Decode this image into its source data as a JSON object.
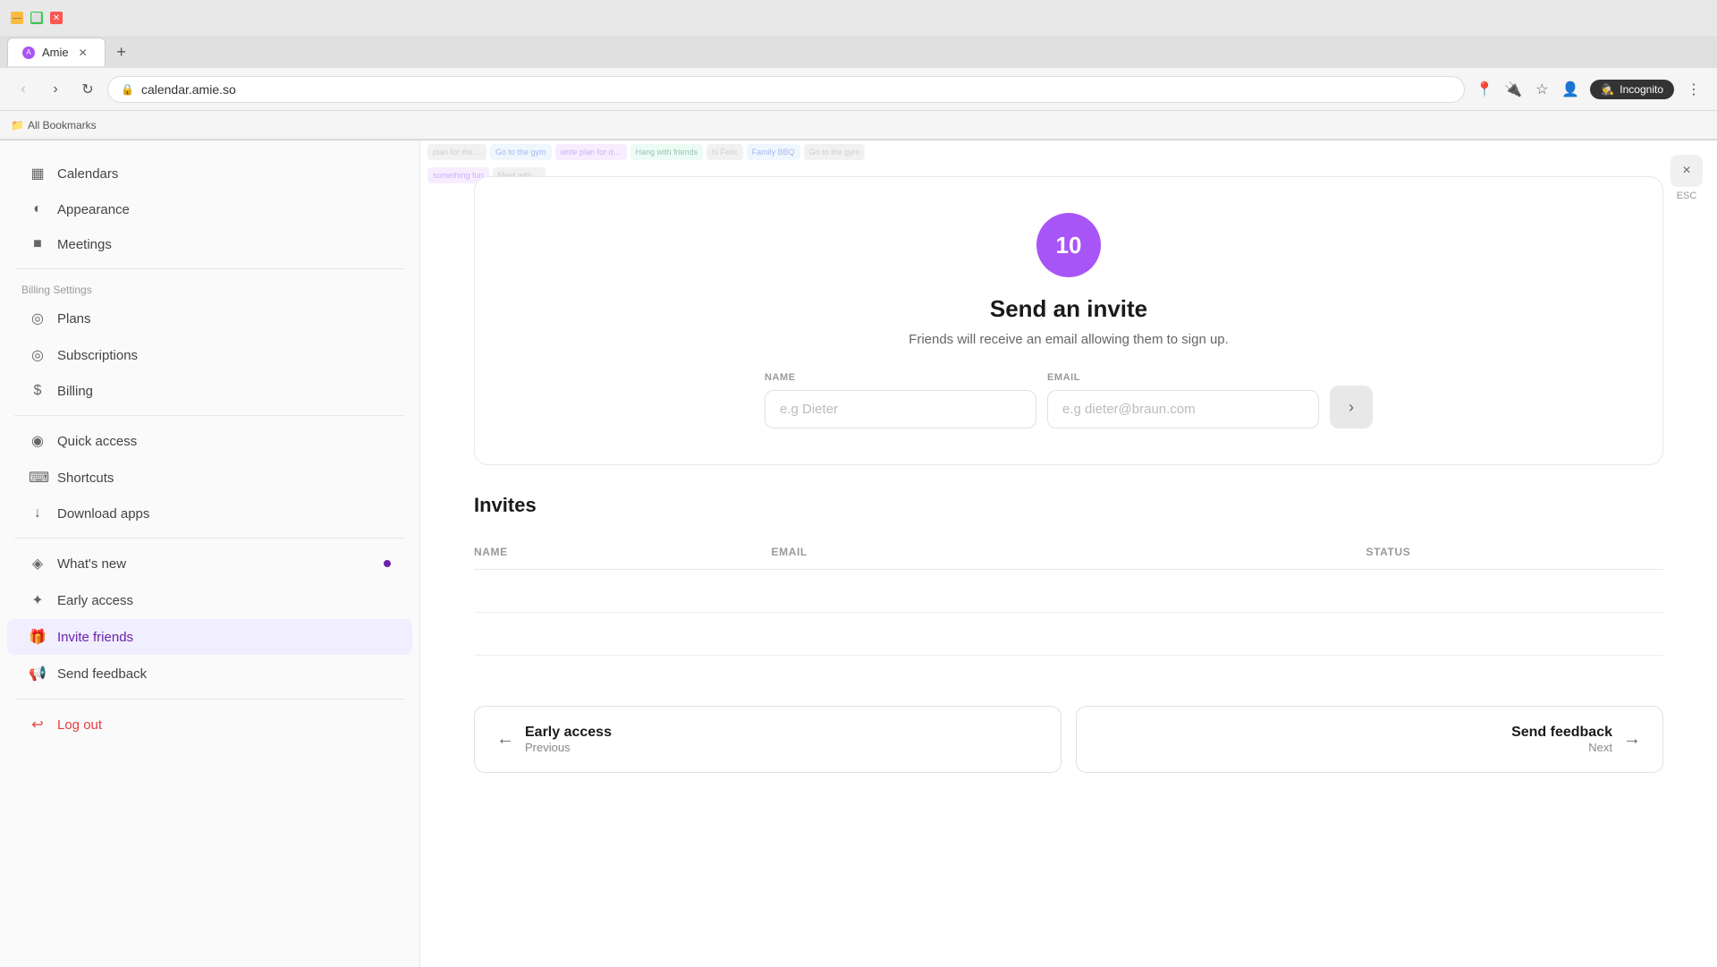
{
  "browser": {
    "tab_title": "Amie",
    "url": "calendar.amie.so",
    "new_tab_label": "+",
    "incognito_label": "Incognito",
    "bookmarks_label": "All Bookmarks"
  },
  "sidebar": {
    "sections": {
      "calendars_label": "Calendars",
      "billing_label": "Billing Settings"
    },
    "items": [
      {
        "id": "calendars",
        "label": "Calendars",
        "icon": "▦"
      },
      {
        "id": "appearance",
        "label": "Appearance",
        "icon": "◐"
      },
      {
        "id": "meetings",
        "label": "Meetings",
        "icon": "■"
      },
      {
        "id": "plans",
        "label": "Plans",
        "icon": "◎"
      },
      {
        "id": "subscriptions",
        "label": "Subscriptions",
        "icon": "◎"
      },
      {
        "id": "billing",
        "label": "Billing",
        "icon": "$"
      },
      {
        "id": "quick-access",
        "label": "Quick access",
        "icon": "◉"
      },
      {
        "id": "shortcuts",
        "label": "Shortcuts",
        "icon": "⌨"
      },
      {
        "id": "download-apps",
        "label": "Download apps",
        "icon": "↓"
      },
      {
        "id": "whats-new",
        "label": "What's new",
        "icon": "◈",
        "has_dot": true
      },
      {
        "id": "early-access",
        "label": "Early access",
        "icon": "✦"
      },
      {
        "id": "invite-friends",
        "label": "Invite friends",
        "icon": "🎁",
        "active": true
      },
      {
        "id": "send-feedback",
        "label": "Send feedback",
        "icon": "📢"
      },
      {
        "id": "log-out",
        "label": "Log out",
        "icon": "↩",
        "is_logout": true
      }
    ]
  },
  "main": {
    "invite_badge_number": "10",
    "send_invite_title": "Send an invite",
    "send_invite_subtitle": "Friends will receive an email allowing them to sign up.",
    "name_label": "NAME",
    "email_label": "EMAIL",
    "name_placeholder": "e.g Dieter",
    "email_placeholder": "e.g dieter@braun.com",
    "invites_section_title": "Invites",
    "table_headers": {
      "name": "NAME",
      "email": "EMAIL",
      "status": "STATUS"
    },
    "nav_prev": {
      "title": "Early access",
      "sub": "Previous"
    },
    "nav_next": {
      "title": "Send feedback",
      "sub": "Next"
    },
    "close_label": "×",
    "esc_label": "ESC"
  }
}
